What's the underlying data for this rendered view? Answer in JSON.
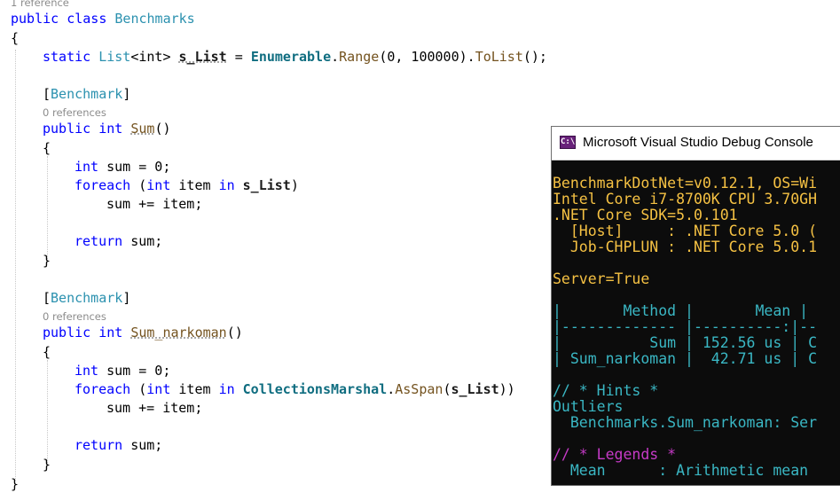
{
  "editor": {
    "lens_class": "1 reference",
    "lens_method1": "0 references",
    "lens_method2": "0 references",
    "class_line": {
      "kw_public": "public",
      "kw_class": "class",
      "name": "Benchmarks"
    },
    "brace_open": "{",
    "brace_close": "}",
    "field_line": {
      "kw_static": "static",
      "type_list": "List",
      "generic": "<int>",
      "field": "s_List",
      "eq": " = ",
      "enumerable": "Enumerable",
      "dot1": ".",
      "range": "Range",
      "args": "(0, 100000).",
      "tolist": "ToList",
      "end": "();"
    },
    "attr1": {
      "open": "[",
      "name": "Benchmark",
      "close": "]"
    },
    "attr2": {
      "open": "[",
      "name": "Benchmark",
      "close": "]"
    },
    "sum_sig": {
      "kw_public": "public",
      "kw_int": "int",
      "name": "Sum",
      "parens": "()"
    },
    "sum_decl": {
      "kw_int": "int",
      "rest": " sum = 0;"
    },
    "sum_foreach": {
      "kw_foreach": "foreach",
      "paren": " (",
      "kw_int": "int",
      "item": " item ",
      "kw_in": "in",
      "field": "s_List",
      "end": ")"
    },
    "sum_accum": "sum += item;",
    "sum_return": {
      "kw_return": "return",
      "rest": " sum;"
    },
    "nark_sig": {
      "kw_public": "public",
      "kw_int": "int",
      "name": "Sum_narkoman",
      "parens": "()"
    },
    "nark_decl": {
      "kw_int": "int",
      "rest": " sum = 0;"
    },
    "nark_foreach": {
      "kw_foreach": "foreach",
      "paren": " (",
      "kw_int": "int",
      "item": " item ",
      "kw_in": "in",
      "cm": "CollectionsMarshal",
      "dot": ".",
      "asspan": "AsSpan",
      "open": "(",
      "field": "s_List",
      "end": "))"
    },
    "nark_accum": "sum += item;",
    "nark_return": {
      "kw_return": "return",
      "rest": " sum;"
    }
  },
  "console": {
    "title": "Microsoft Visual Studio Debug Console",
    "icon_label": "C:\\",
    "lines": {
      "l1": "BenchmarkDotNet=v0.12.1, OS=Wi",
      "l2": "Intel Core i7-8700K CPU 3.70GH",
      "l3": ".NET Core SDK=5.0.101",
      "l4": "  [Host]     : .NET Core 5.0 (",
      "l5": "  Job-CHPLUN : .NET Core 5.0.1",
      "l6": "Server=True",
      "t1": "|       Method |       Mean |",
      "t2": "|------------- |----------:|--",
      "t3": "|          Sum | 152.56 us | C",
      "t4": "| Sum_narkoman |  42.71 us | C",
      "h1": "// * Hints *",
      "h2": "Outliers",
      "h3": "  Benchmarks.Sum_narkoman: Ser",
      "g1": "// * Legends *",
      "g2": "  Mean      : Arithmetic mean"
    }
  },
  "colors": {
    "keyword": "#0000ff",
    "type": "#2b91af",
    "method": "#74531f",
    "console_bg": "#0c0c0c",
    "console_yellow": "#f5c143",
    "console_cyan": "#3ab7c4",
    "console_magenta": "#c63ac7"
  },
  "icons": {
    "console": "vs-console-icon"
  }
}
